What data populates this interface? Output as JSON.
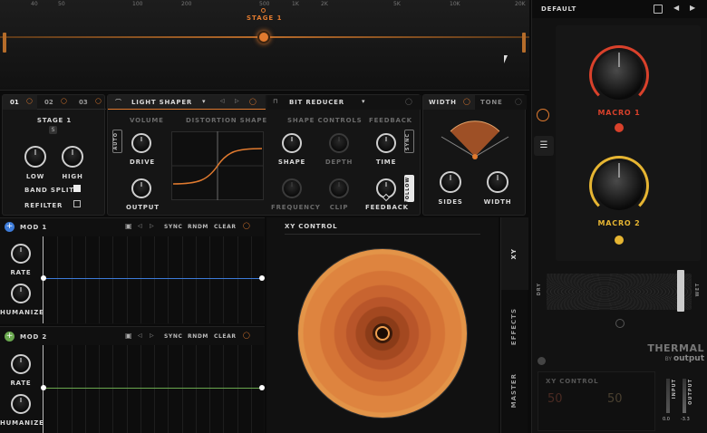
{
  "spectrum": {
    "freq_labels": [
      "40",
      "50",
      "100",
      "200",
      "500",
      "1K",
      "2K",
      "5K",
      "10K",
      "20K"
    ],
    "stage_label": "STAGE 1"
  },
  "stage_tabs": [
    "01",
    "02",
    "03"
  ],
  "stage_panel": {
    "title": "STAGE 1",
    "solo_badge": "S",
    "low_label": "LOW",
    "high_label": "HIGH",
    "band_split_label": "BAND SPLIT",
    "refilter_label": "REFILTER"
  },
  "effect_tabs": {
    "light_shaper": "LIGHT SHAPER",
    "bit_reducer": "BIT REDUCER"
  },
  "shaper": {
    "volume_label": "VOLUME",
    "auto_label": "AUTO",
    "drive_label": "DRIVE",
    "output_label": "OUTPUT",
    "distortion_shape_label": "DISTORTION SHAPE",
    "shape_controls_label": "SHAPE CONTROLS",
    "shape_label": "SHAPE",
    "depth_label": "DEPTH",
    "frequency_label": "FREQUENCY",
    "clip_label": "CLIP",
    "feedback_header": "FEEDBACK",
    "time_label": "TIME",
    "feedback_label": "FEEDBACK",
    "sync_label": "SYNC",
    "follow_label": "FOLLOW"
  },
  "width_panel": {
    "width_tab": "WIDTH",
    "tone_tab": "TONE",
    "sides_label": "SIDES",
    "width_label": "WIDTH"
  },
  "mod1": {
    "title": "MOD 1",
    "sync": "SYNC",
    "rndm": "RNDM",
    "clear": "CLEAR",
    "rate_label": "RATE",
    "humanize_label": "HUMANIZE",
    "line_color": "#3d7bd8",
    "dot_color": "#4a7fe0"
  },
  "mod2": {
    "title": "MOD 2",
    "sync": "SYNC",
    "rndm": "RNDM",
    "clear": "CLEAR",
    "rate_label": "RATE",
    "humanize_label": "HUMANIZE",
    "line_color": "#6aa84f",
    "dot_color": "#6aa84f"
  },
  "xy": {
    "title": "XY CONTROL",
    "side_tabs": [
      "XY",
      "EFFECTS",
      "MASTER"
    ]
  },
  "right_panel": {
    "preset_name": "DEFAULT",
    "macro1_label": "MACRO 1",
    "macro2_label": "MACRO 2",
    "dry_label": "DRY",
    "wet_label": "WET",
    "brand": "THERMAL",
    "by_label": "BY",
    "maker": "output",
    "xy_control_label": "XY CONTROL",
    "x_value": "50",
    "y_value": "50",
    "input_label": "INPUT",
    "output_label": "OUTPUT",
    "input_value": "0.0",
    "output_value": "-3.3"
  },
  "colors": {
    "accent_orange": "#e07a2f",
    "macro1_red": "#d9412b",
    "macro2_yellow": "#e6b532",
    "mod1_blue": "#3d7bd8",
    "mod2_green": "#6aa84f"
  }
}
